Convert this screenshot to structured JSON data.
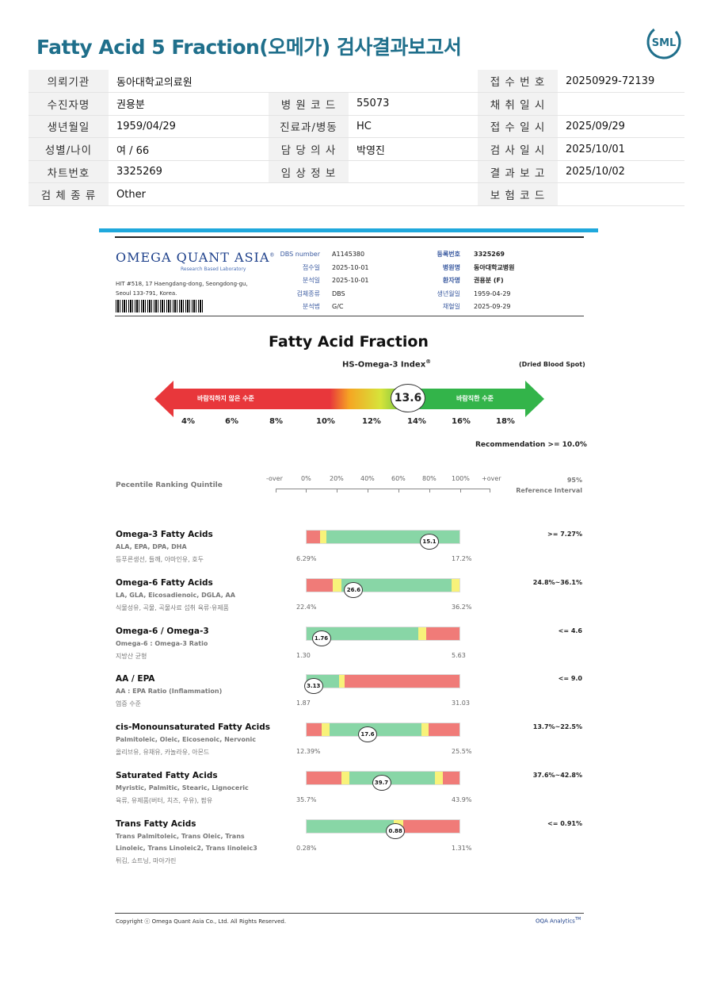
{
  "report": {
    "title": "Fatty Acid 5 Fraction(오메가) 검사결과보고서",
    "logo_text": "SML"
  },
  "info_rows": [
    [
      {
        "label": "의뢰기관",
        "value": "동아대학교의료원"
      },
      {
        "label": "",
        "value": ""
      },
      {
        "label": "접 수 번 호",
        "value": "20250929-72139"
      }
    ],
    [
      {
        "label": "수진자명",
        "value": "권용분"
      },
      {
        "label": "병 원 코 드",
        "value": "55073"
      },
      {
        "label": "채 취 일 시",
        "value": ""
      }
    ],
    [
      {
        "label": "생년월일",
        "value": "1959/04/29"
      },
      {
        "label": "진료과/병동",
        "value": "HC"
      },
      {
        "label": "접 수 일 시",
        "value": "2025/09/29"
      }
    ],
    [
      {
        "label": "성별/나이",
        "value": "여 / 66"
      },
      {
        "label": "담 당 의 사",
        "value": "박영진"
      },
      {
        "label": "검 사 일 시",
        "value": "2025/10/01"
      }
    ],
    [
      {
        "label": "차트번호",
        "value": "3325269"
      },
      {
        "label": "임 상 정 보",
        "value": ""
      },
      {
        "label": "결 과 보 고",
        "value": "2025/10/02"
      }
    ],
    [
      {
        "label": "검 체 종 류",
        "value": "Other"
      },
      {
        "label": "",
        "value": ""
      },
      {
        "label": "보 험 코 드",
        "value": ""
      }
    ]
  ],
  "lab": {
    "name": "OMEGA QUANT ASIA",
    "registered_mark": "®",
    "subtitle": "Research Based Laboratory",
    "address_line1": "HIT #518, 17 Haengdang-dong, Seongdong-gu,",
    "address_line2": "Seoul 133-791, Korea."
  },
  "sample_meta": {
    "dbs_label": "DBS number",
    "dbs_value": "A1145380",
    "received_label": "접수일",
    "received_value": "2025-10-01",
    "analyzed_label": "분석일",
    "analyzed_value": "2025-10-01",
    "specimen_label": "검체종류",
    "specimen_value": "DBS",
    "method_label": "분석법",
    "method_value": "G/C",
    "reg_label": "등록번호",
    "reg_value": "3325269",
    "hospital_label": "병원명",
    "hospital_value": "동아대학교병원",
    "patient_label": "환자명",
    "patient_value": "권용분 (F)",
    "birth_label": "생년월일",
    "birth_value": "1959-04-29",
    "draw_label": "채혈일",
    "draw_value": "2025-09-29"
  },
  "index_section": {
    "title": "Fatty Acid Fraction",
    "index_label": "HS-Omega-3 Index",
    "index_mark": "®",
    "sample_type": "(Dried Blood Spot)",
    "bad_label": "바람직하지 않은 수준",
    "good_label": "바람직한 수준",
    "value": "13.6",
    "ticks": [
      "4%",
      "6%",
      "8%",
      "10%",
      "12%",
      "14%",
      "16%",
      "18%"
    ],
    "recommendation": "Recommendation  >= 10.0%",
    "colors": {
      "red": "#e8373b",
      "orange": "#f5a623",
      "yellow": "#d6e43a",
      "green": "#33b44a"
    }
  },
  "percentile": {
    "title": "Pecentile Ranking Quintile",
    "scale": [
      "-over",
      "0%",
      "20%",
      "40%",
      "60%",
      "80%",
      "100%",
      "+over"
    ],
    "ref_header1": "95%",
    "ref_header2": "Reference Interval"
  },
  "rows": [
    {
      "title": "Omega-3 Fatty Acids",
      "sub": [
        "ALA, EPA, DPA, DHA"
      ],
      "food": "등푸른생선, 들깨, 아마인유, 호두",
      "value": "15.1",
      "position": 0.8,
      "min": "6.29%",
      "max": "17.2%",
      "ref": ">= 7.27%",
      "segments": [
        [
          "red",
          0.09
        ],
        [
          "yellow",
          0.04
        ],
        [
          "green",
          0.87
        ]
      ]
    },
    {
      "title": "Omega-6 Fatty Acids",
      "sub": [
        "LA, GLA, Eicosadienoic, DGLA, AA"
      ],
      "food": "식물성유, 곡물, 곡물사료 섭취 육류·유제품",
      "value": "26.6",
      "position": 0.31,
      "min": "22.4%",
      "max": "36.2%",
      "ref": "24.8%~36.1%",
      "segments": [
        [
          "red",
          0.17
        ],
        [
          "yellow",
          0.06
        ],
        [
          "green",
          0.72
        ],
        [
          "yellow",
          0.05
        ]
      ]
    },
    {
      "title": "Omega-6 / Omega-3",
      "sub": [
        "Omega-6 : Omega-3 Ratio"
      ],
      "food": "지방산 균형",
      "value": "1.76",
      "position": 0.1,
      "min": "1.30",
      "max": "5.63",
      "ref": "<= 4.6",
      "segments": [
        [
          "green",
          0.73
        ],
        [
          "yellow",
          0.05
        ],
        [
          "red",
          0.22
        ]
      ]
    },
    {
      "title": "AA / EPA",
      "sub": [
        "AA : EPA Ratio (Inflammation)"
      ],
      "food": "염증 수준",
      "value": "3.13",
      "position": 0.05,
      "min": "1.87",
      "max": "31.03",
      "ref": "<= 9.0",
      "segments": [
        [
          "green",
          0.21
        ],
        [
          "yellow",
          0.04
        ],
        [
          "red",
          0.75
        ]
      ]
    },
    {
      "title": "cis-Monounsaturated Fatty Acids",
      "sub": [
        "Palmitoleic, Oleic, Eicosenoic, Nervonic"
      ],
      "food": "올리브유, 유채유, 카놀라유, 아몬드",
      "value": "17.6",
      "position": 0.4,
      "min": "12.39%",
      "max": "25.5%",
      "ref": "13.7%~22.5%",
      "segments": [
        [
          "red",
          0.1
        ],
        [
          "yellow",
          0.05
        ],
        [
          "green",
          0.6
        ],
        [
          "yellow",
          0.05
        ],
        [
          "red",
          0.2
        ]
      ]
    },
    {
      "title": "Saturated Fatty Acids",
      "sub": [
        "Myristic, Palmitic, Stearic, Lignoceric"
      ],
      "food": "육류, 유제품(버터, 치즈, 우유), 팜유",
      "value": "39.7",
      "position": 0.49,
      "min": "35.7%",
      "max": "43.9%",
      "ref": "37.6%~42.8%",
      "segments": [
        [
          "red",
          0.23
        ],
        [
          "yellow",
          0.05
        ],
        [
          "green",
          0.56
        ],
        [
          "yellow",
          0.05
        ],
        [
          "red",
          0.11
        ]
      ]
    },
    {
      "title": "Trans Fatty Acids",
      "sub": [
        "Trans Palmitoleic, Trans Oleic, Trans",
        "Linoleic, Trans Linoleic2, Trans linoleic3"
      ],
      "food": "튀김, 쇼트닝, 마아가린",
      "value": "0.88",
      "position": 0.58,
      "min": "0.28%",
      "max": "1.31%",
      "ref": "<= 0.91%",
      "segments": [
        [
          "green",
          0.57
        ],
        [
          "yellow",
          0.06
        ],
        [
          "red",
          0.37
        ]
      ]
    }
  ],
  "bar_colors": {
    "red": "#f07b78",
    "yellow": "#f8f27a",
    "green": "#88d6a6"
  },
  "footer": {
    "copyright": "Copyright ⓒ Omega Quant Asia Co., Ltd.  All Rights Reserved.",
    "analytics": "OQA Analytics",
    "analytics_mark": "TM"
  }
}
